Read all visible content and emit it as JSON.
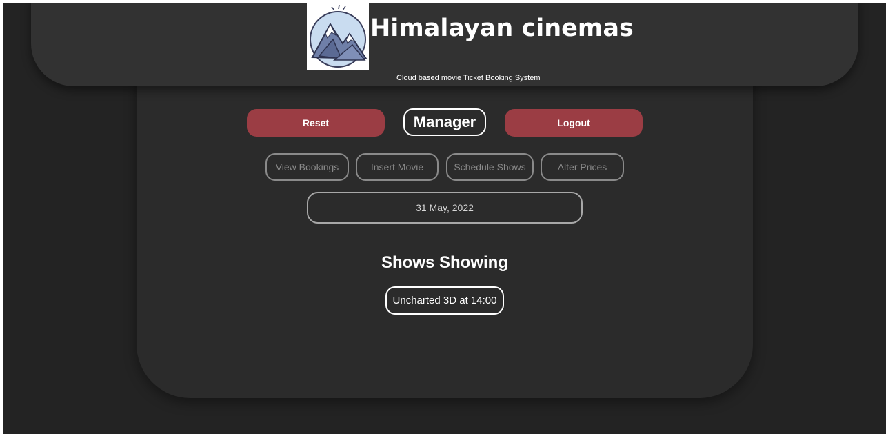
{
  "header": {
    "title": "Himalayan cinemas",
    "subtitle": "Cloud based movie Ticket Booking System",
    "logo_icon": "mountain-logo-icon"
  },
  "toolbar": {
    "reset_label": "Reset",
    "role_label": "Manager",
    "logout_label": "Logout"
  },
  "nav": {
    "items": [
      {
        "label": "View Bookings"
      },
      {
        "label": "Insert Movie"
      },
      {
        "label": "Schedule Shows"
      },
      {
        "label": "Alter Prices"
      }
    ]
  },
  "date": {
    "value": "31 May, 2022"
  },
  "shows": {
    "heading": "Shows Showing",
    "items": [
      {
        "label": "Uncharted 3D at 14:00"
      }
    ]
  },
  "colors": {
    "page_background": "#232323",
    "header_background": "#323232",
    "panel_background": "#2b2b2b",
    "accent_red": "#9b3d44",
    "muted_text": "#8a8a8a",
    "text": "#ffffff"
  }
}
